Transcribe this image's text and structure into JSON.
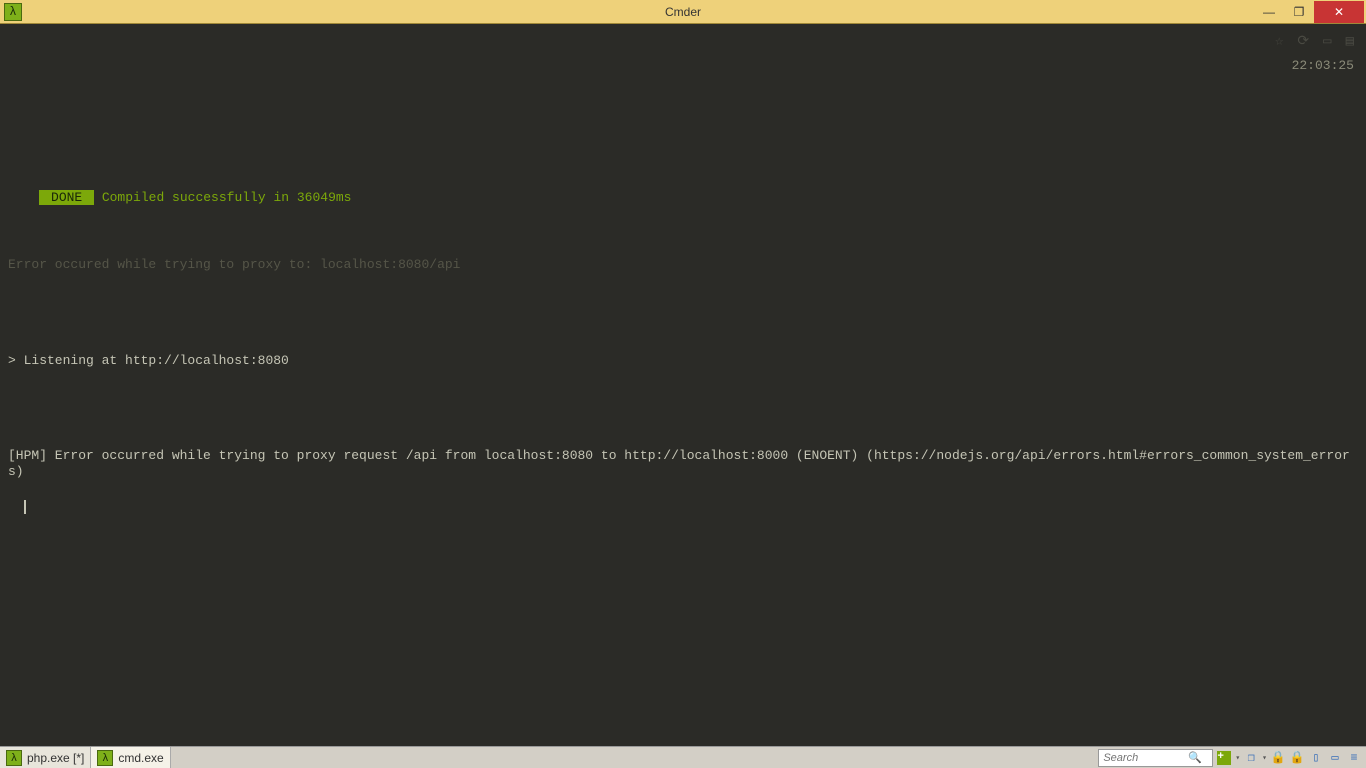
{
  "window": {
    "title": "Cmder",
    "lambda": "λ"
  },
  "terminal": {
    "dim_line1": "",
    "done_badge": " DONE ",
    "compiled_text": " Compiled successfully in 36049ms",
    "dim_line2": "Error occured while trying to proxy to: localhost:8080/api",
    "listening": "> Listening at http://localhost:8080",
    "error": "[HPM] Error occurred while trying to proxy request /api from localhost:8080 to http://localhost:8000 (ENOENT) (https://nodejs.org/api/errors.html#errors_common_system_errors)",
    "timestamp": "22:03:25"
  },
  "footer": {
    "tabs": [
      {
        "label": "php.exe [*]"
      },
      {
        "label": "cmd.exe"
      }
    ],
    "search_placeholder": "Search"
  }
}
